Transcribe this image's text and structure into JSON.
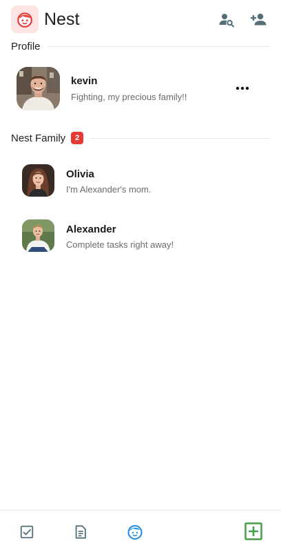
{
  "header": {
    "title": "Nest",
    "logo_icon": "baby-face-icon",
    "actions": [
      {
        "icon": "search-user-icon"
      },
      {
        "icon": "add-user-icon"
      }
    ]
  },
  "profile_section": {
    "title": "Profile",
    "user": {
      "name": "kevin",
      "status": "Fighting, my precious family!!"
    },
    "more_icon": "more-horizontal-icon"
  },
  "family_section": {
    "title": "Nest Family",
    "count": "2",
    "members": [
      {
        "name": "Olivia",
        "status": "I'm Alexander's mom."
      },
      {
        "name": "Alexander",
        "status": "Complete tasks right away!"
      }
    ]
  },
  "bottom_nav": {
    "items": [
      {
        "icon": "checkbox-icon"
      },
      {
        "icon": "notes-icon"
      },
      {
        "icon": "baby-face-icon",
        "active": true
      },
      {
        "icon": "add-square-icon"
      }
    ]
  },
  "colors": {
    "accent_red": "#e53935",
    "active_blue": "#1e88e5",
    "add_green": "#43a047",
    "icon_gray": "#546e7a"
  }
}
